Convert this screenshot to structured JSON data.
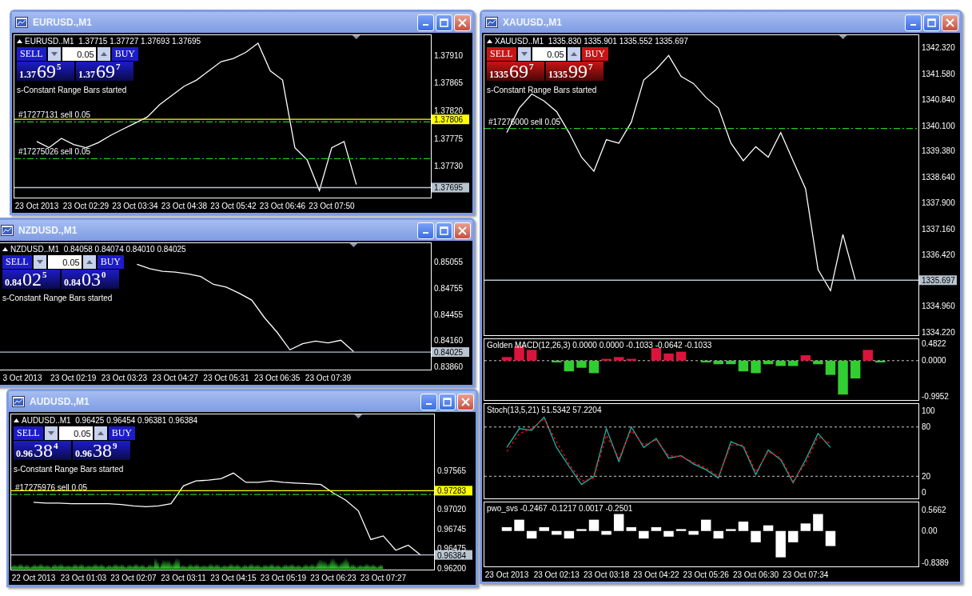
{
  "windows": [
    {
      "title": "EURUSD.,M1",
      "quote": "EURUSD..M1  1.37715 1.37727 1.37693 1.37695",
      "message": "s-Constant Range Bars started",
      "trade_panel": {
        "color": "#1c1cc8",
        "sell": "SELL",
        "buy": "BUY",
        "lot": "0.05",
        "sell_price": {
          "base": "1.37",
          "pips": "69",
          "fraction": "5"
        },
        "buy_price": {
          "base": "1.37",
          "pips": "69",
          "fraction": "7"
        }
      },
      "chart_data": {
        "type": "line",
        "ylim": [
          1.3768,
          1.37943
        ],
        "yticks": [
          {
            "value": 1.3791,
            "label": "1.37910"
          },
          {
            "value": 1.37865,
            "label": "1.37865"
          },
          {
            "value": 1.3782,
            "label": "1.37820"
          },
          {
            "value": 1.37775,
            "label": "1.37775"
          },
          {
            "value": 1.3773,
            "label": "1.37730"
          }
        ],
        "categories": [
          "23 Oct 2013",
          null,
          null,
          null,
          "23 Oct 02:29",
          null,
          null,
          null,
          "23 Oct 03:34",
          null,
          null,
          null,
          "23 Oct 04:38",
          null,
          null,
          null,
          "23 Oct 05:42",
          null,
          null,
          null,
          "23 Oct 06:46",
          null,
          null,
          null,
          "23 Oct 07:50",
          null,
          null,
          null,
          null,
          null,
          null,
          null
        ],
        "series": [
          {
            "color": "#ffffff",
            "values": [
              1.3777,
              1.3776,
              1.37775,
              1.37765,
              1.3776,
              1.37768,
              1.3778,
              1.3779,
              1.378,
              1.3781,
              1.3783,
              1.37845,
              1.3786,
              1.3787,
              1.37885,
              1.379,
              1.37905,
              1.37915,
              1.3793,
              1.37885,
              1.3787,
              1.3776,
              1.3774,
              1.3769,
              1.3776,
              1.3777,
              1.377,
              null,
              null,
              null,
              null,
              null
            ]
          }
        ],
        "ref_lines": [
          {
            "axis": "y",
            "value": 1.37802,
            "label": "#17277131 sell 0.05",
            "color": "#22cc22",
            "line_style": "dashdot"
          },
          {
            "axis": "y",
            "value": 1.37806,
            "label": "1.37806",
            "color": "#ffff00"
          },
          {
            "axis": "y",
            "value": 1.37742,
            "label": "#17275026 sell 0.05",
            "color": "#22cc22",
            "line_style": "dashdot"
          },
          {
            "axis": "y",
            "value": 1.37695,
            "label": "1.37695",
            "color": "#b8c4d0"
          }
        ]
      }
    },
    {
      "title": "NZDUSD.,M1",
      "quote": "NZDUSD..M1  0.84058 0.84074 0.84010 0.84025",
      "message": "s-Constant Range Bars started",
      "trade_panel": {
        "color": "#1c1cc8",
        "sell": "SELL",
        "buy": "BUY",
        "lot": "0.05",
        "sell_price": {
          "base": "0.84",
          "pips": "02",
          "fraction": "5"
        },
        "buy_price": {
          "base": "0.84",
          "pips": "03",
          "fraction": "0"
        }
      },
      "chart_data": {
        "type": "line",
        "ylim": [
          0.83833,
          0.85272
        ],
        "yticks": [
          {
            "value": 0.85055,
            "label": "0.85055"
          },
          {
            "value": 0.84755,
            "label": "0.84755"
          },
          {
            "value": 0.84455,
            "label": "0.84455"
          },
          {
            "value": 0.8416,
            "label": "0.84160"
          },
          {
            "value": 0.8386,
            "label": "0.83860"
          }
        ],
        "categories": [
          "3 Oct 2013",
          null,
          null,
          null,
          "23 Oct 02:19",
          null,
          null,
          null,
          "23 Oct 03:23",
          null,
          null,
          null,
          "23 Oct 04:27",
          null,
          null,
          null,
          "23 Oct 05:31",
          null,
          null,
          null,
          "23 Oct 06:35",
          null,
          null,
          null,
          "23 Oct 07:39",
          null,
          null,
          null,
          null,
          null,
          null,
          null
        ],
        "series": [
          {
            "color": "#ffffff",
            "values": [
              null,
              null,
              null,
              null,
              null,
              null,
              null,
              null,
              null,
              0.8503,
              0.8498,
              0.8495,
              0.8494,
              0.8492,
              0.8489,
              0.848,
              0.8477,
              0.847,
              0.8462,
              0.8442,
              0.8425,
              0.8405,
              0.8412,
              0.8415,
              0.8413,
              0.8416,
              0.8403,
              null,
              null,
              null,
              null,
              null
            ]
          }
        ],
        "ref_lines": [
          {
            "axis": "y",
            "value": 0.84025,
            "label": "0.84025",
            "color": "#b8c4d0"
          }
        ]
      }
    },
    {
      "title": "AUDUSD.,M1",
      "quote": "AUDUSD..M1  0.96425 0.96454 0.96381 0.96384",
      "message": "s-Constant Range Bars started",
      "volume": true,
      "trade_panel": {
        "color": "#1c1cc8",
        "sell": "SELL",
        "buy": "BUY",
        "lot": "0.05",
        "sell_price": {
          "base": "0.96",
          "pips": "38",
          "fraction": "4"
        },
        "buy_price": {
          "base": "0.96",
          "pips": "38",
          "fraction": "9"
        }
      },
      "chart_data": {
        "type": "line",
        "ylim": [
          0.9619,
          0.9835
        ],
        "yticks": [
          {
            "value": 0.97565,
            "label": "0.97565"
          },
          {
            "value": 0.9702,
            "label": "0.97020"
          },
          {
            "value": 0.96745,
            "label": "0.96745"
          },
          {
            "value": 0.96475,
            "label": "0.96475"
          },
          {
            "value": 0.962,
            "label": "0.96200"
          }
        ],
        "categories": [
          "22 Oct 2013",
          null,
          null,
          null,
          "23 Oct 01:03",
          null,
          null,
          null,
          "23 Oct 02:07",
          null,
          null,
          null,
          "23 Oct 03:11",
          null,
          null,
          null,
          "23 Oct 04:15",
          null,
          null,
          null,
          "23 Oct 05:19",
          null,
          null,
          null,
          "23 Oct 06:23",
          null,
          null,
          null,
          "23 Oct 07:27",
          null,
          null,
          null
        ],
        "series": [
          {
            "color": "#ffffff",
            "values": [
              0.9712,
              0.9711,
              0.9711,
              0.971,
              0.971,
              0.971,
              0.971,
              0.9709,
              0.9707,
              0.9706,
              0.9707,
              0.971,
              0.9735,
              0.9742,
              0.9743,
              0.9745,
              0.9753,
              0.974,
              0.974,
              0.9742,
              0.974,
              0.9739,
              0.9738,
              0.9737,
              0.9725,
              0.9715,
              0.97,
              0.966,
              0.9665,
              0.9645,
              0.9652,
              0.9638
            ]
          }
        ],
        "ref_lines": [
          {
            "axis": "y",
            "value": 0.9723,
            "label": "#17275976 sell 0.05",
            "color": "#22cc22",
            "line_style": "dashdot"
          },
          {
            "axis": "y",
            "value": 0.97283,
            "label": "0.97283",
            "color": "#ffff00"
          },
          {
            "axis": "y",
            "value": 0.96384,
            "label": "0.96384",
            "color": "#b8c4d0"
          }
        ]
      }
    },
    {
      "title": "XAUUSD.,M1",
      "quote": "XAUUSD..M1  1335.830 1335.901 1335.552 1335.697",
      "message": "s-Constant Range Bars started",
      "trade_panel": {
        "color": "#c81414",
        "sell": "SELL",
        "buy": "BUY",
        "lot": "0.05",
        "sell_price": {
          "base": "1335",
          "pips": "69",
          "fraction": "7"
        },
        "buy_price": {
          "base": "1335",
          "pips": "99",
          "fraction": "7"
        }
      },
      "chart_data": {
        "type": "line",
        "ylim": [
          1334.153,
          1342.676
        ],
        "yticks": [
          {
            "value": 1342.32,
            "label": "1342.320"
          },
          {
            "value": 1341.58,
            "label": "1341.580"
          },
          {
            "value": 1340.84,
            "label": "1340.840"
          },
          {
            "value": 1340.1,
            "label": "1340.100"
          },
          {
            "value": 1339.38,
            "label": "1339.380"
          },
          {
            "value": 1338.64,
            "label": "1338.640"
          },
          {
            "value": 1337.9,
            "label": "1337.900"
          },
          {
            "value": 1337.16,
            "label": "1337.160"
          },
          {
            "value": 1336.42,
            "label": "1336.420"
          },
          {
            "value": 1334.96,
            "label": "1334.960"
          },
          {
            "value": 1334.22,
            "label": "1334.220"
          }
        ],
        "series": [
          {
            "color": "#ffffff",
            "values": [
              1339.9,
              1340.6,
              1341,
              1340.8,
              1340.5,
              1339.9,
              1339.2,
              1338.8,
              1339.7,
              1339.6,
              1340.2,
              1341.4,
              1341.7,
              1342.1,
              1341.5,
              1341.3,
              1340.9,
              1340.6,
              1339.6,
              1339.1,
              1339.5,
              1339.2,
              1339.9,
              1339.1,
              1338.3,
              1336,
              1335.4,
              1337,
              1335.7,
              null,
              null,
              null,
              null
            ]
          }
        ],
        "ref_lines": [
          {
            "axis": "y",
            "value": 1340.02,
            "label": "#17276000 sell 0.05",
            "color": "#22cc22",
            "line_style": "dashdot"
          },
          {
            "axis": "y",
            "value": 1335.697,
            "label": "1335.697",
            "color": "#b8c4d0"
          }
        ]
      },
      "indicators": [
        {
          "chart_data": {
            "type": "bar",
            "title": "Golden MACD(12,26,3) 0.0000 0.0000 -0.1033 -0.0642 -0.1033",
            "ylim": [
              -1.08,
              0.6
            ],
            "yticks": [
              {
                "value": 0.4822,
                "label": "0.4822"
              },
              {
                "value": 0,
                "label": "0.0000"
              },
              {
                "value": -0.9952,
                "label": "-0.9952"
              }
            ],
            "series": [
              {
                "color": "#dc143c",
                "values": [
                  0.1,
                  0.4,
                  0.3,
                  null,
                  null,
                  null,
                  null,
                  null,
                  0.05,
                  0.1,
                  0.05,
                  null,
                  0.35,
                  0.2,
                  0.25,
                  null,
                  null,
                  null,
                  null,
                  null,
                  null,
                  null,
                  null,
                  null,
                  0.15,
                  null,
                  null,
                  null,
                  null,
                  0.3,
                  null,
                  null,
                  null
                ]
              },
              {
                "color": "#32cd32",
                "values": [
                  null,
                  null,
                  null,
                  null,
                  -0.05,
                  -0.3,
                  -0.2,
                  -0.35,
                  null,
                  null,
                  null,
                  null,
                  null,
                  null,
                  null,
                  null,
                  -0.05,
                  -0.1,
                  -0.1,
                  -0.3,
                  -0.35,
                  -0.1,
                  -0.15,
                  -0.15,
                  null,
                  -0.1,
                  -0.4,
                  -0.95,
                  -0.5,
                  null,
                  -0.05,
                  null,
                  null
                ]
              }
            ],
            "ref_lines": [
              {
                "axis": "y",
                "value": 0,
                "color": "#c8c8c8",
                "line_style": "dashed"
              }
            ]
          }
        },
        {
          "chart_data": {
            "type": "line",
            "title": "Stoch(13,5,21) 51.5342 57.2204",
            "ylim": [
              -6,
              108
            ],
            "yticks": [
              {
                "value": 100,
                "label": "100"
              },
              {
                "value": 80,
                "label": "80"
              },
              {
                "value": 20,
                "label": "20"
              },
              {
                "value": 0,
                "label": "0"
              }
            ],
            "series": [
              {
                "color": "#20b2aa",
                "values": [
                  55,
                  78,
                  76,
                  92,
                  55,
                  32,
                  10,
                  20,
                  78,
                  38,
                  80,
                  55,
                  66,
                  42,
                  45,
                  35,
                  28,
                  18,
                  62,
                  56,
                  22,
                  52,
                  40,
                  12,
                  40,
                  72,
                  55,
                  null,
                  null,
                  null,
                  null,
                  null,
                  null
                ]
              },
              {
                "color": "#ff0000",
                "line_style": "dashed",
                "values": [
                  50,
                  72,
                  78,
                  90,
                  62,
                  35,
                  14,
                  18,
                  70,
                  42,
                  76,
                  58,
                  64,
                  45,
                  44,
                  37,
                  30,
                  20,
                  58,
                  58,
                  25,
                  50,
                  42,
                  14,
                  36,
                  68,
                  60,
                  null,
                  null,
                  null,
                  null,
                  null,
                  null
                ]
              }
            ],
            "ref_lines": [
              {
                "axis": "y",
                "value": 80,
                "color": "#c8c8c8",
                "line_style": "dashed"
              },
              {
                "axis": "y",
                "value": 20,
                "color": "#c8c8c8",
                "line_style": "dashed"
              }
            ]
          }
        },
        {
          "chart_data": {
            "type": "bar",
            "title": "pwo_svs -0.2467 -0.1217 0.0017 -0.2501",
            "ylim": [
              -0.92,
              0.76
            ],
            "yticks": [
              {
                "value": 0.5662,
                "label": "0.5662"
              },
              {
                "value": 0,
                "label": "0.00"
              },
              {
                "value": -0.8389,
                "label": "-0.8389"
              }
            ],
            "categories": [
              "23 Oct 2013",
              null,
              null,
              null,
              "23 Oct 02:13",
              null,
              null,
              null,
              "23 Oct 03:18",
              null,
              null,
              null,
              "23 Oct 04:22",
              null,
              null,
              null,
              "23 Oct 05:26",
              null,
              null,
              null,
              "23 Oct 06:30",
              null,
              null,
              null,
              "23 Oct 07:34",
              null,
              null,
              null,
              null,
              null,
              null,
              null,
              null
            ],
            "series": [
              {
                "color": "#ffffff",
                "values": [
                  0.1,
                  0.3,
                  -0.2,
                  0.1,
                  -0.1,
                  -0.2,
                  0.05,
                  0.3,
                  -0.1,
                  0.45,
                  0.1,
                  -0.2,
                  0.1,
                  -0.15,
                  0.05,
                  -0.1,
                  0.3,
                  -0.2,
                  0.05,
                  0.25,
                  -0.3,
                  0.15,
                  -0.7,
                  -0.3,
                  0.2,
                  0.45,
                  -0.4,
                  null,
                  null,
                  null,
                  null,
                  null,
                  null
                ]
              }
            ]
          }
        }
      ]
    }
  ]
}
